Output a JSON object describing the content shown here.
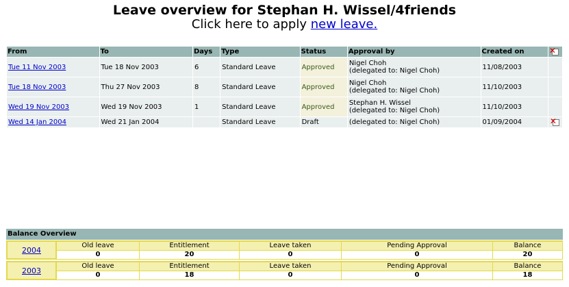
{
  "header": {
    "title": "Leave overview for Stephan H. Wissel/4friends",
    "apply_prefix": "Click here to apply ",
    "apply_link": "new leave."
  },
  "leave_table": {
    "columns": [
      "From",
      "To",
      "Days",
      "Type",
      "Status",
      "Approval by",
      "Created on"
    ],
    "rows": [
      {
        "from": "Tue 11 Nov 2003",
        "to": "Tue 18 Nov 2003",
        "days": "6",
        "type": "Standard Leave",
        "status": "Approved",
        "approver": "Nigel Choh",
        "delegated": "(delegated to: Nigel Choh)",
        "created": "11/08/2003"
      },
      {
        "from": "Tue 18 Nov 2003",
        "to": "Thu 27 Nov 2003",
        "days": "8",
        "type": "Standard Leave",
        "status": "Approved",
        "approver": "Nigel Choh",
        "delegated": "(delegated to: Nigel Choh)",
        "created": "11/10/2003"
      },
      {
        "from": "Wed 19 Nov 2003",
        "to": "Wed 19 Nov 2003",
        "days": "1",
        "type": "Standard Leave",
        "status": "Approved",
        "approver": "Stephan H. Wissel",
        "delegated": "(delegated to: Nigel Choh)",
        "created": "11/10/2003"
      },
      {
        "from": "Wed 14 Jan 2004",
        "to": "Wed 21 Jan 2004",
        "days": "",
        "type": "Standard Leave",
        "status": "Draft",
        "approver": "",
        "delegated": "(delegated to: Nigel Choh)",
        "created": "01/09/2004"
      }
    ]
  },
  "balance": {
    "title": "Balance Overview",
    "labels": [
      "Old leave",
      "Entitlement",
      "Leave taken",
      "Pending Approval",
      "Balance"
    ],
    "years": [
      {
        "year": "2004",
        "values": [
          "0",
          "20",
          "0",
          "0",
          "20"
        ]
      },
      {
        "year": "2003",
        "values": [
          "0",
          "18",
          "0",
          "0",
          "18"
        ]
      }
    ]
  },
  "colors": {
    "header_bg": "#98b6b3",
    "row_bg": "#e9efee",
    "balance_frame": "#e3d94a",
    "link": "#0000cc"
  },
  "icons": {
    "delete": "delete-document-icon"
  }
}
